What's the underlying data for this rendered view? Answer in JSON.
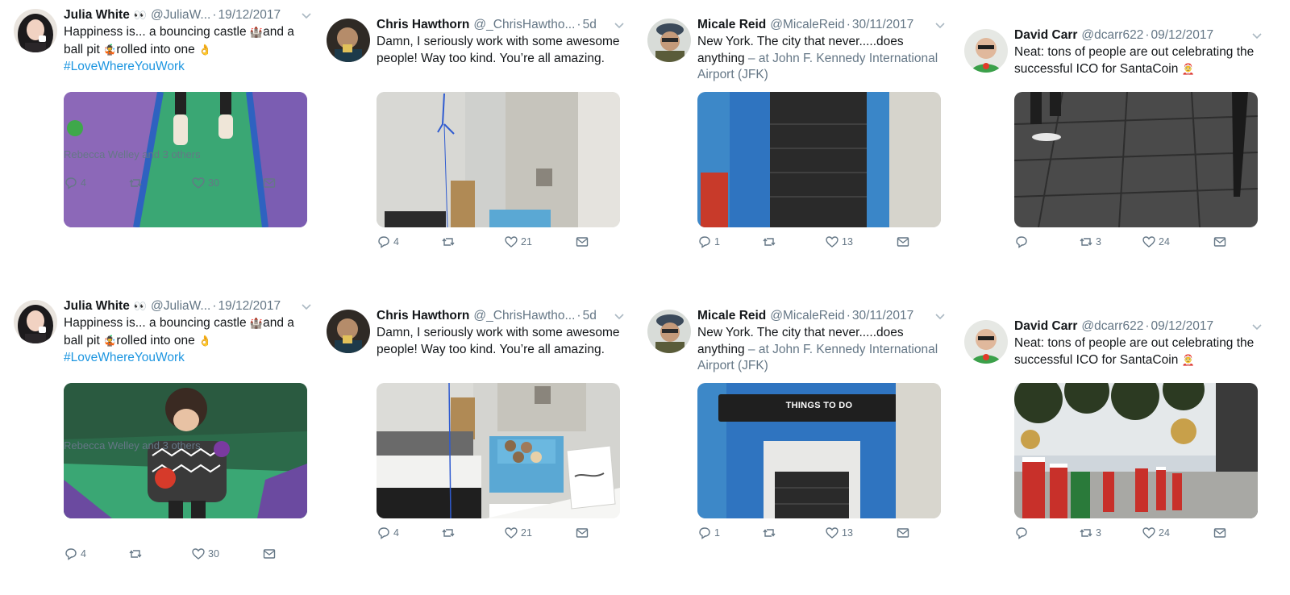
{
  "colors": {
    "text": "#14171a",
    "muted": "#657786",
    "link": "#1b95e0"
  },
  "tweets": [
    {
      "name": "Julia White",
      "badge": "👀",
      "handle": "@JuliaW...",
      "dot": "·",
      "date": "19/12/2017",
      "text_a": "Happiness is... a bouncing castle ",
      "emoji1": "🏰",
      "text_b": "and a ball pit ",
      "emoji2": "🤹",
      "text_c": "rolled into one ",
      "emoji3": "👌",
      "hashtag": "#LoveWhereYouWork",
      "social_context": "Rebecca Welley and 3 others",
      "replies": "4",
      "retweets": "",
      "likes": "30",
      "icons": [
        "reply-icon",
        "retweet-icon",
        "heart-icon",
        "message-icon"
      ]
    },
    {
      "name": "Chris Hawthorn",
      "handle": "@_ChrisHawtho...",
      "dot": "·",
      "date": "5d",
      "text": "Damn, I seriously work with some awesome people! Way too kind. You’re all amazing.",
      "replies": "4",
      "retweets": "",
      "likes": "21"
    },
    {
      "name": "Micale Reid",
      "handle": "@MicaleReid",
      "dot": "·",
      "date": "30/11/2017",
      "text": "New York. The city that never.....does anything ",
      "location": "– at John F. Kennedy International Airport (JFK)",
      "replies": "1",
      "retweets": "",
      "likes": "13"
    },
    {
      "name": "David Carr",
      "handle": "@dcarr622",
      "dot": "·",
      "date": "09/12/2017",
      "text": "Neat: tons of people are out celebrating the successful ICO for SantaCoin ",
      "emoji": "🤶",
      "replies": "",
      "retweets": "3",
      "likes": "24"
    }
  ]
}
